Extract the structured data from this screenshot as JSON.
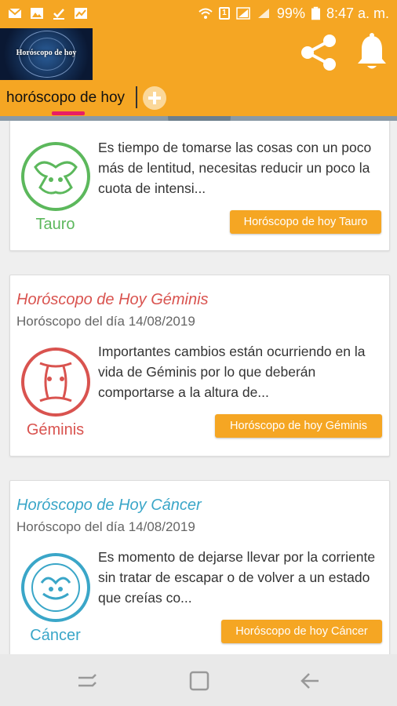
{
  "status_bar": {
    "battery": "99%",
    "time": "8:47 a. m.",
    "sim_label": "1"
  },
  "app_bar": {
    "logo_text": "Horóscopo de hoy"
  },
  "tabs": {
    "active_label": "horóscopo de hoy"
  },
  "cards": [
    {
      "sign": "Tauro",
      "description": "Es tiempo de tomarse las cosas con un poco más de lentitud, necesitas reducir un poco la cuota de intensi...",
      "button": "Horóscopo de hoy Tauro",
      "color": "#5cb85c"
    },
    {
      "title": "Horóscopo de Hoy Géminis",
      "date": "Horóscopo del día 14/08/2019",
      "sign": "Géminis",
      "description": "Importantes cambios están ocurriendo en la vida de Géminis por lo que deberán comportarse a la altura de...",
      "button": "Horóscopo de hoy Géminis",
      "color": "#d9534f"
    },
    {
      "title": "Horóscopo de Hoy Cáncer",
      "date": "Horóscopo del día 14/08/2019",
      "sign": "Cáncer",
      "description": "Es momento de dejarse llevar por la corriente sin tratar de escapar o de volver a un estado que creías co...",
      "button": "Horóscopo de hoy Cáncer",
      "color": "#3aa6c8"
    }
  ],
  "colors": {
    "accent": "#f5a623",
    "tab_indicator": "#e91e63"
  },
  "icons": {
    "share": "share-icon",
    "bell": "bell-icon",
    "add_tab": "plus-icon",
    "collapse": "chevron-down-icon",
    "nav_recents": "recents-icon",
    "nav_home": "home-icon",
    "nav_back": "back-icon"
  }
}
